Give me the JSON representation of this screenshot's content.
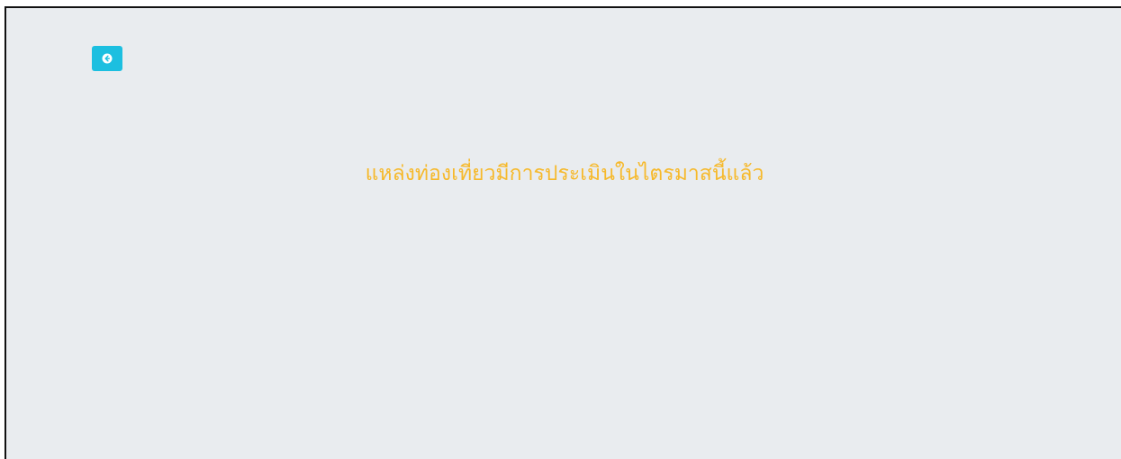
{
  "theme": {
    "background_color": "#e9ecef",
    "accent_color": "#1cbfe0",
    "message_color": "#f6b92b"
  },
  "back_button": {
    "icon": "arrow-left-circle-icon"
  },
  "message": {
    "text": "แหล่งท่องเที่ยวมีการประเมินในไตรมาสนี้แล้ว"
  }
}
